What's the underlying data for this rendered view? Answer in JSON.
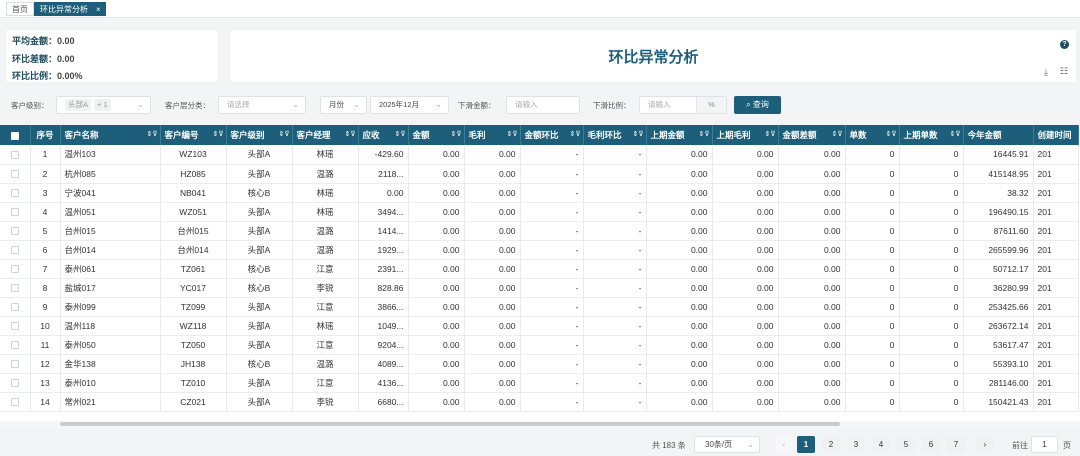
{
  "tabs": {
    "home": "首页",
    "active": "环比异常分析",
    "close": "×"
  },
  "summary": {
    "avg_label": "平均金额：",
    "avg_value": "0.00",
    "diff_label": "环比差额：",
    "diff_value": "0.00",
    "ratio_label": "环比比例：",
    "ratio_value": "0.00%"
  },
  "title": "环比异常分析",
  "icons": {
    "help": "?",
    "download": "⤓",
    "settings": "☷"
  },
  "filters": {
    "level_label": "客户级别：",
    "level_tag": "头部A",
    "level_more": "+ 1",
    "cat_label": "客户层分类：",
    "cat_placeholder": "请选择",
    "period": "月份",
    "month": "2025年12月",
    "amount_label": "下滑金额：",
    "amount_placeholder": "请输入",
    "ratio_label": "下滑比例：",
    "ratio_placeholder": "请输入",
    "ratio_unit": "%",
    "query": "查询"
  },
  "table": {
    "headers": [
      "序号",
      "客户名称",
      "客户编号",
      "客户级别",
      "客户经理",
      "应收",
      "金额",
      "毛利",
      "金额环比",
      "毛利环比",
      "上期金额",
      "上期毛利",
      "金额差额",
      "单数",
      "上期单数",
      "今年金额",
      "创建时间"
    ],
    "rows": [
      [
        "1",
        "温州103",
        "WZ103",
        "头部A",
        "林瑶",
        "-429.60",
        "0.00",
        "0.00",
        "-",
        "-",
        "0.00",
        "0.00",
        "0.00",
        "0",
        "0",
        "16445.91",
        "201"
      ],
      [
        "2",
        "杭州085",
        "HZ085",
        "头部A",
        "温潞",
        "2118...",
        "0.00",
        "0.00",
        "-",
        "-",
        "0.00",
        "0.00",
        "0.00",
        "0",
        "0",
        "415148.95",
        "201"
      ],
      [
        "3",
        "宁波041",
        "NB041",
        "核心B",
        "林瑶",
        "0.00",
        "0.00",
        "0.00",
        "-",
        "-",
        "0.00",
        "0.00",
        "0.00",
        "0",
        "0",
        "38.32",
        "201"
      ],
      [
        "4",
        "温州051",
        "WZ051",
        "头部A",
        "林瑶",
        "3494...",
        "0.00",
        "0.00",
        "-",
        "-",
        "0.00",
        "0.00",
        "0.00",
        "0",
        "0",
        "196490.15",
        "201"
      ],
      [
        "5",
        "台州015",
        "台州015",
        "头部A",
        "温潞",
        "1414...",
        "0.00",
        "0.00",
        "-",
        "-",
        "0.00",
        "0.00",
        "0.00",
        "0",
        "0",
        "87611.60",
        "201"
      ],
      [
        "6",
        "台州014",
        "台州014",
        "头部A",
        "温潞",
        "1929...",
        "0.00",
        "0.00",
        "-",
        "-",
        "0.00",
        "0.00",
        "0.00",
        "0",
        "0",
        "265599.96",
        "201"
      ],
      [
        "7",
        "泰州061",
        "TZ061",
        "核心B",
        "江意",
        "2391...",
        "0.00",
        "0.00",
        "-",
        "-",
        "0.00",
        "0.00",
        "0.00",
        "0",
        "0",
        "50712.17",
        "201"
      ],
      [
        "8",
        "盐城017",
        "YC017",
        "核心B",
        "李锐",
        "828.86",
        "0.00",
        "0.00",
        "-",
        "-",
        "0.00",
        "0.00",
        "0.00",
        "0",
        "0",
        "36280.99",
        "201"
      ],
      [
        "9",
        "泰州099",
        "TZ099",
        "头部A",
        "江意",
        "3866...",
        "0.00",
        "0.00",
        "-",
        "-",
        "0.00",
        "0.00",
        "0.00",
        "0",
        "0",
        "253425.66",
        "201"
      ],
      [
        "10",
        "温州118",
        "WZ118",
        "头部A",
        "林瑶",
        "1049...",
        "0.00",
        "0.00",
        "-",
        "-",
        "0.00",
        "0.00",
        "0.00",
        "0",
        "0",
        "263672.14",
        "201"
      ],
      [
        "11",
        "泰州050",
        "TZ050",
        "头部A",
        "江意",
        "9204...",
        "0.00",
        "0.00",
        "-",
        "-",
        "0.00",
        "0.00",
        "0.00",
        "0",
        "0",
        "53617.47",
        "201"
      ],
      [
        "12",
        "金华138",
        "JH138",
        "核心B",
        "温潞",
        "4089...",
        "0.00",
        "0.00",
        "-",
        "-",
        "0.00",
        "0.00",
        "0.00",
        "0",
        "0",
        "55393.10",
        "201"
      ],
      [
        "13",
        "泰州010",
        "TZ010",
        "头部A",
        "江意",
        "4136...",
        "0.00",
        "0.00",
        "-",
        "-",
        "0.00",
        "0.00",
        "0.00",
        "0",
        "0",
        "281146.00",
        "201"
      ],
      [
        "14",
        "常州021",
        "CZ021",
        "头部A",
        "李锐",
        "6680...",
        "0.00",
        "0.00",
        "-",
        "-",
        "0.00",
        "0.00",
        "0.00",
        "0",
        "0",
        "150421.43",
        "201"
      ]
    ]
  },
  "pager": {
    "total": "共 183 条",
    "size": "30条/页",
    "prev": "‹",
    "next": "›",
    "pages": [
      "1",
      "2",
      "3",
      "4",
      "5",
      "6",
      "7"
    ],
    "goto_label": "前往",
    "goto_value": "1",
    "goto_suffix": "页"
  }
}
